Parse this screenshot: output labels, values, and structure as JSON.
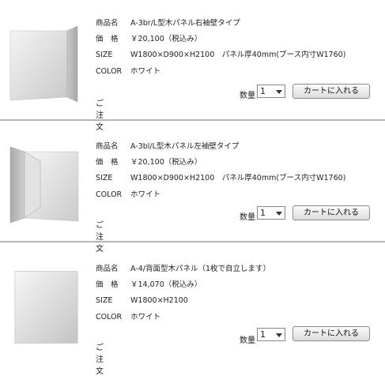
{
  "labels": {
    "name": "商品名",
    "price": "価　格",
    "size": "SIZE",
    "color": "COLOR",
    "order": "ご注文",
    "quantity": "数量",
    "cart_button": "カートに入れる"
  },
  "products": [
    {
      "name": "A-3br/L型木パネル右袖壁タイプ",
      "price": "￥20,100（税込み）",
      "size": "W1800×D900×H2100　パネル厚40mm(ブース内寸W1760)",
      "color": "ホワイト",
      "quantity": "1",
      "image_icon": "l-shaped-panel-right-icon"
    },
    {
      "name": "A-3bl/L型木パネル左袖壁タイプ",
      "price": "￥20,100（税込み）",
      "size": "W1800×D900×H2100　パネル厚40mm(ブース内寸W1760)",
      "color": "ホワイト",
      "quantity": "1",
      "image_icon": "l-shaped-panel-left-icon"
    },
    {
      "name": "A-4/背面型木パネル（1枚で自立します）",
      "price": "￥14,070（税込み）",
      "size": "W1800×H2100",
      "color": "ホワイト",
      "quantity": "1",
      "image_icon": "back-panel-icon"
    }
  ]
}
